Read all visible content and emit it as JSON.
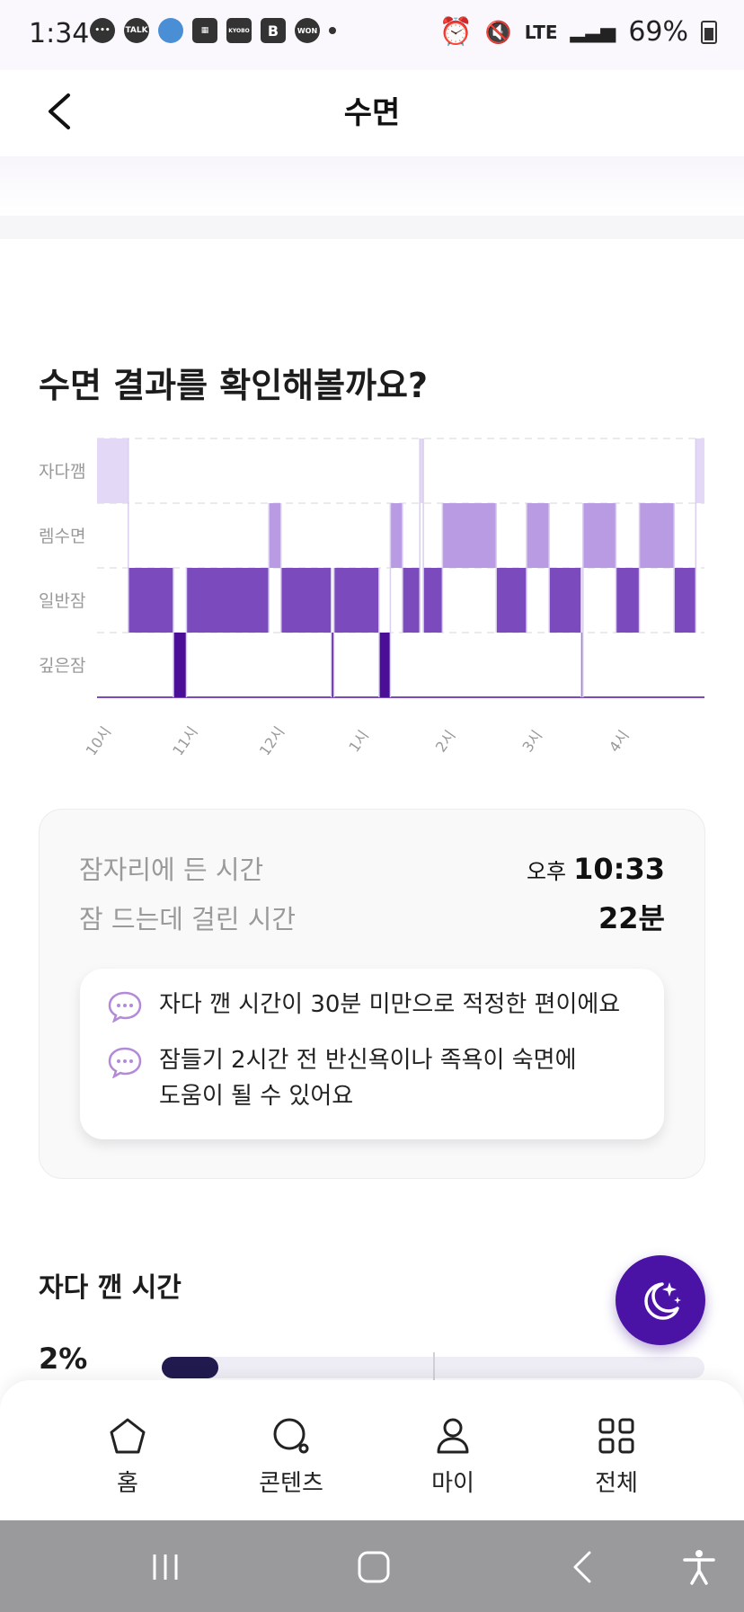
{
  "status_bar": {
    "time": "1:34",
    "left_icons": [
      "chat-icon",
      "talk-icon",
      "globe-icon",
      "news-icon",
      "kyobo-icon",
      "b-icon",
      "won-icon"
    ],
    "talk_label": "TALK",
    "kyobo_label": "KYOBO",
    "b_label": "B",
    "won_label": "WON",
    "network": "LTE",
    "battery": "69%"
  },
  "header": {
    "title": "수면"
  },
  "section_title": "수면 결과를 확인해볼까요?",
  "chart_data": {
    "type": "timeline",
    "y_categories": [
      "자다깸",
      "렘수면",
      "일반잠",
      "깊은잠"
    ],
    "x_ticks": [
      "10시",
      "11시",
      "12시",
      "1시",
      "2시",
      "3시",
      "4시"
    ],
    "x_range_hours": [
      22.0,
      29.0
    ],
    "colors": {
      "자다깸": "#e3d8f5",
      "렘수면": "#b99be3",
      "일반잠": "#7b4bbe",
      "깊은잠": "#4a0f96"
    },
    "segments": [
      {
        "stage": "자다깸",
        "start": 22.0,
        "end": 22.36
      },
      {
        "stage": "일반잠",
        "start": 22.36,
        "end": 22.88
      },
      {
        "stage": "깊은잠",
        "start": 22.88,
        "end": 23.03
      },
      {
        "stage": "일반잠",
        "start": 23.03,
        "end": 23.98
      },
      {
        "stage": "렘수면",
        "start": 23.98,
        "end": 24.12
      },
      {
        "stage": "일반잠",
        "start": 24.12,
        "end": 24.7
      },
      {
        "stage": "깊은잠",
        "start": 24.7,
        "end": 24.73
      },
      {
        "stage": "일반잠",
        "start": 24.73,
        "end": 25.25
      },
      {
        "stage": "깊은잠",
        "start": 25.25,
        "end": 25.38
      },
      {
        "stage": "렘수면",
        "start": 25.38,
        "end": 25.52
      },
      {
        "stage": "일반잠",
        "start": 25.52,
        "end": 25.72
      },
      {
        "stage": "자다깸",
        "start": 25.72,
        "end": 25.76
      },
      {
        "stage": "일반잠",
        "start": 25.76,
        "end": 25.98
      },
      {
        "stage": "렘수면",
        "start": 25.98,
        "end": 26.6
      },
      {
        "stage": "일반잠",
        "start": 26.6,
        "end": 26.95
      },
      {
        "stage": "렘수면",
        "start": 26.95,
        "end": 27.21
      },
      {
        "stage": "일반잠",
        "start": 27.21,
        "end": 27.58
      },
      {
        "stage": "깊은잠",
        "start": 27.58,
        "end": 27.6
      },
      {
        "stage": "렘수면",
        "start": 27.6,
        "end": 27.98
      },
      {
        "stage": "일반잠",
        "start": 27.98,
        "end": 28.25
      },
      {
        "stage": "렘수면",
        "start": 28.25,
        "end": 28.65
      },
      {
        "stage": "일반잠",
        "start": 28.65,
        "end": 28.9
      },
      {
        "stage": "자다깸",
        "start": 28.9,
        "end": 29.0
      }
    ]
  },
  "summary": {
    "bedtime_label": "잠자리에 든 시간",
    "bedtime_ampm": "오후",
    "bedtime_value": "10:33",
    "latency_label": "잠 드는데 걸린 시간",
    "latency_value": "22분",
    "tips": [
      {
        "text": "자다 깬 시간이 30분 미만으로 적정한 편이에요"
      },
      {
        "text_line1": "잠들기 2시간 전 반신욕이나 족욕이 숙면에",
        "text_line2": "도움이 될 수 있어요"
      }
    ]
  },
  "awake": {
    "title": "자다 깬 시간",
    "percent_label": "2%",
    "fill_fraction": 0.105,
    "accent": "#211a4f"
  },
  "fab": {
    "icon": "moon-stars-icon",
    "color": "#4b12a6"
  },
  "bottom_nav": {
    "items": [
      {
        "label": "홈",
        "icon": "home-icon"
      },
      {
        "label": "콘텐츠",
        "icon": "content-search-icon"
      },
      {
        "label": "마이",
        "icon": "person-icon"
      },
      {
        "label": "전체",
        "icon": "grid-icon"
      }
    ]
  }
}
